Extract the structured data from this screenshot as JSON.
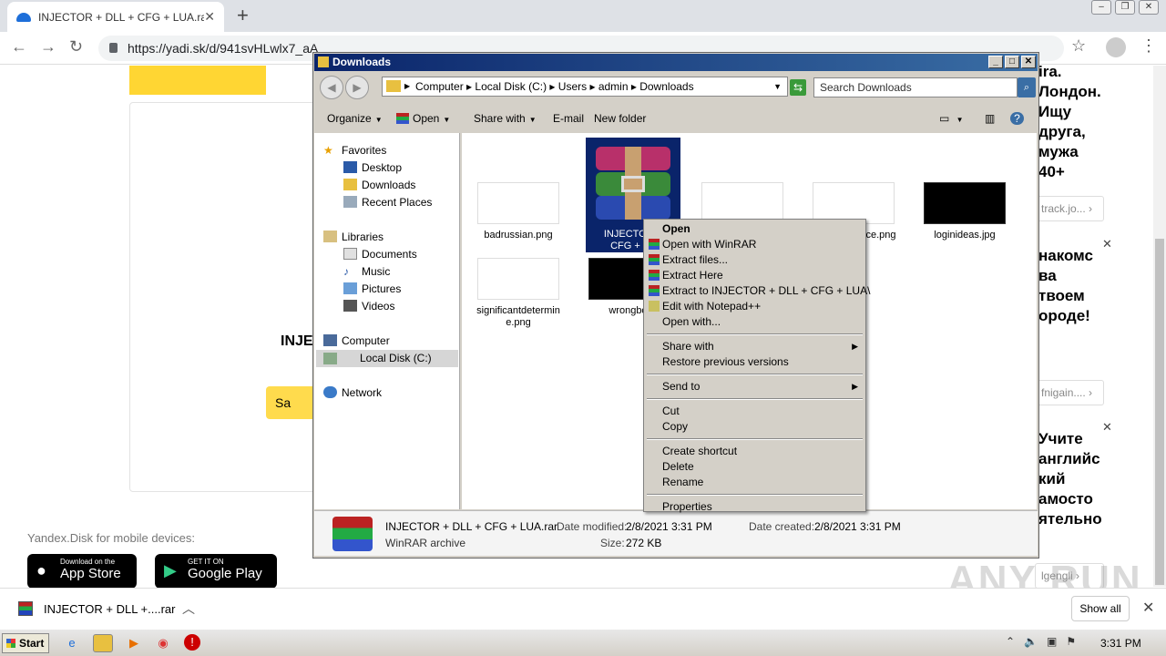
{
  "browser": {
    "tab_title": "INJECTOR + DLL + CFG + LUA.rar –",
    "url": "https://yadi.sk/d/941svHLwlx7_aA"
  },
  "page": {
    "heading_partial": "INJE",
    "save_partial": "Sa",
    "mobile_text": "Yandex.Disk for mobile devices:",
    "appstore_small": "Download on the",
    "appstore_big": "App Store",
    "googleplay_small": "GET IT ON",
    "googleplay_big": "Google Play",
    "ad1_lines": "ira.\nЛондон.\nИщу\nдруга,\nмужа\n40+",
    "ad1_link": "track.jo...",
    "ad2_lines": "накомс\nва\nтвоем\nороде!",
    "ad2_link": "fnigain....",
    "ad3_lines": "Учите\nанглийс\nкий\nамосто\nятельно",
    "ad3_link": "lgengli",
    "watermark": "ANY RUN"
  },
  "explorer": {
    "title": "Downloads",
    "breadcrumb": [
      "Computer",
      "Local Disk (C:)",
      "Users",
      "admin",
      "Downloads"
    ],
    "search_placeholder": "Search Downloads",
    "commands": [
      "Organize",
      "Open",
      "Share with",
      "E-mail",
      "New folder"
    ],
    "nav": {
      "favorites": "Favorites",
      "desktop": "Desktop",
      "downloads": "Downloads",
      "recent": "Recent Places",
      "libraries": "Libraries",
      "documents": "Documents",
      "music": "Music",
      "pictures": "Pictures",
      "videos": "Videos",
      "computer": "Computer",
      "local_disk": "Local Disk (C:)",
      "network": "Network"
    },
    "files": {
      "f1": "badrussian.png",
      "f2_line1": "INJECTOR +",
      "f2_line2": "CFG + LU",
      "f4": "ce.png",
      "f5": "loginideas.jpg",
      "f6_line1": "significantdetermin",
      "f6_line2": "e.png",
      "f7": "wrongbot"
    },
    "details": {
      "name": "INJECTOR + DLL + CFG + LUA.rar",
      "type": "WinRAR archive",
      "modified_label": "Date modified:",
      "modified": "2/8/2021 3:31 PM",
      "created_label": "Date created:",
      "created": "2/8/2021 3:31 PM",
      "size_label": "Size:",
      "size": "272 KB"
    }
  },
  "context_menu": {
    "open": "Open",
    "open_winrar": "Open with WinRAR",
    "extract_files": "Extract files...",
    "extract_here": "Extract Here",
    "extract_to": "Extract to INJECTOR + DLL + CFG + LUA\\",
    "edit_notepad": "Edit with Notepad++",
    "open_with": "Open with...",
    "share_with": "Share with",
    "restore": "Restore previous versions",
    "send_to": "Send to",
    "cut": "Cut",
    "copy": "Copy",
    "create_shortcut": "Create shortcut",
    "delete": "Delete",
    "rename": "Rename",
    "properties": "Properties"
  },
  "download_bar": {
    "item": "INJECTOR + DLL +....rar",
    "show_all": "Show all"
  },
  "taskbar": {
    "start": "Start",
    "clock": "3:31 PM"
  }
}
